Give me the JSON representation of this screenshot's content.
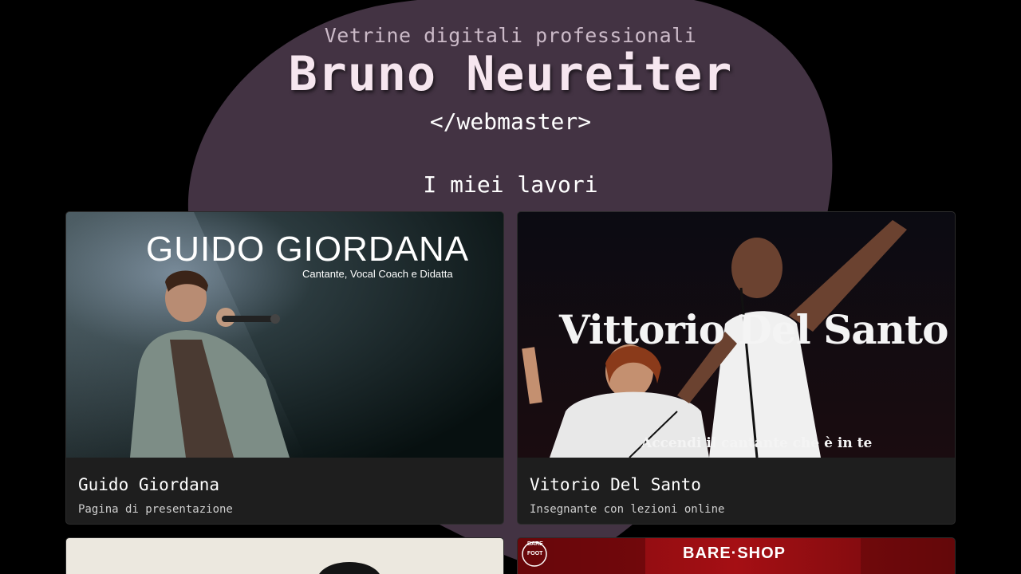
{
  "header": {
    "tagline": "Vetrine digitali professionali",
    "name": "Bruno Neureiter",
    "role": "</webmaster>"
  },
  "section": {
    "title": "I miei lavori"
  },
  "works": [
    {
      "title": "Guido Giordana",
      "description": "Pagina di presentazione",
      "image_heading": "GUIDO GIORDANA",
      "image_subheading": "Cantante, Vocal Coach e Didatta"
    },
    {
      "title": "Vitorio Del Santo",
      "description": "Insegnante con lezioni online",
      "image_heading": "Vittorio Del Santo",
      "image_subheading": "Accendi il cantante che è in te"
    },
    {
      "title": "",
      "description": ""
    },
    {
      "title": "",
      "description": "",
      "image_brand": "BARE·SHOP",
      "image_logo_top": "BARE",
      "image_logo_bottom": "FOOT"
    }
  ],
  "colors": {
    "background": "#000000",
    "blob": "#433343",
    "card": "#1e1e1e"
  }
}
